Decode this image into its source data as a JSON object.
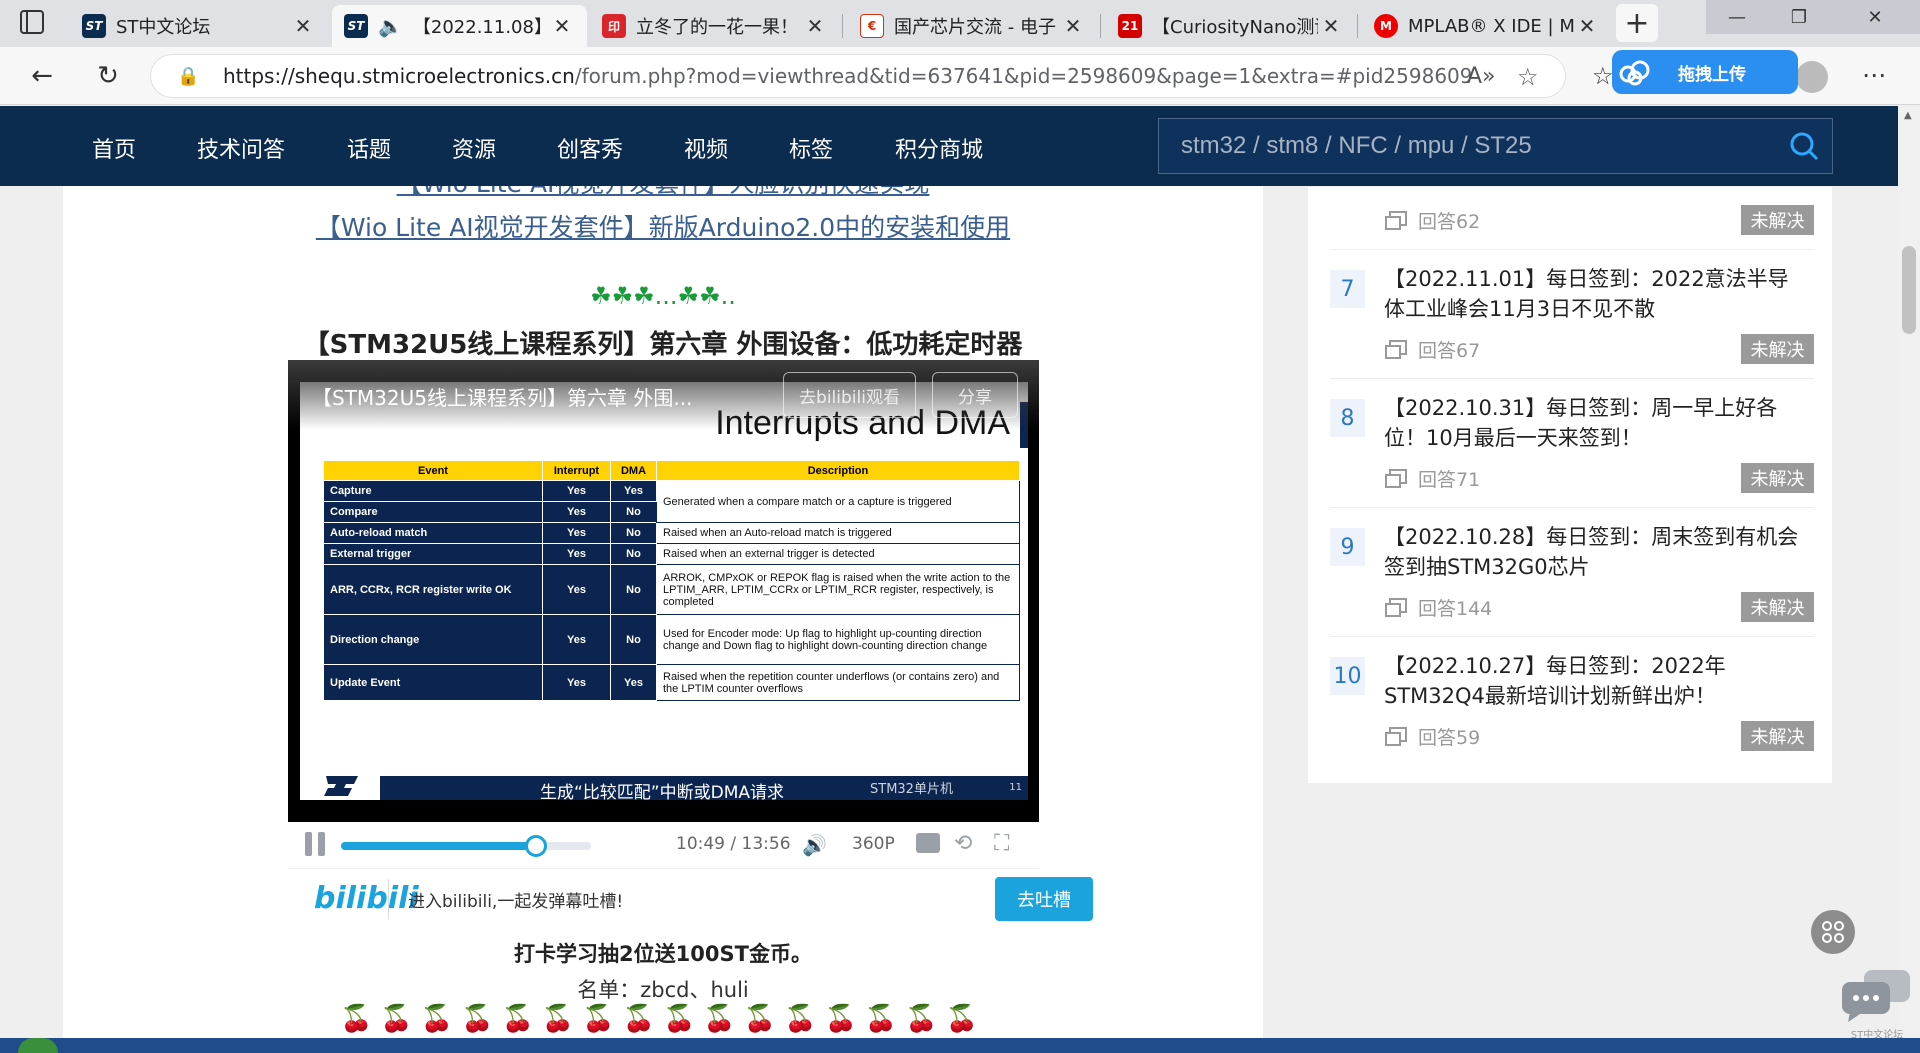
{
  "browser": {
    "tabs": [
      {
        "title": "ST中文论坛",
        "icon": "st-logo-icon"
      },
      {
        "title": "【2022.11.08】",
        "icon": "st-logo-icon"
      },
      {
        "title": "立冬了的一花一果！",
        "icon": "red-app-icon"
      },
      {
        "title": "国产芯片交流 - 电子",
        "icon": "eefocus-icon"
      },
      {
        "title": "【CuriosityNano测评",
        "icon": "21ic-icon"
      },
      {
        "title": "MPLAB® X IDE | Mi",
        "icon": "microchip-icon"
      }
    ],
    "url_host": "https://shequ.stmicroelectronics.cn",
    "url_path": "/forum.php?mod=viewthread&tid=637641&pid=2598609&page=1&extra=#pid2598609",
    "upload_label": "拖拽上传"
  },
  "site_nav": {
    "items": [
      "首页",
      "技术问答",
      "话题",
      "资源",
      "创客秀",
      "视频",
      "标签",
      "积分商城"
    ],
    "search_placeholder": "stm32 / stm8 / NFC / mpu / ST25"
  },
  "article": {
    "link_partial": "【Wio Lite AI视觉开发套件】人脸识别快速实现",
    "link_2": "【Wio Lite AI视觉开发套件】新版Arduino2.0中的安装和使用",
    "deco_clovers": "☘☘☘...☘☘..",
    "section_title": "【STM32U5线上课程系列】第六章 外围设备：低功耗定时器",
    "video": {
      "title": "【STM32U5线上课程系列】第六章 外围...",
      "open_bilibili": "去bilibili观看",
      "share": "分享",
      "slide_heading": "Interrupts and DMA",
      "table_headers": [
        "Event",
        "Interrupt",
        "DMA",
        "Description"
      ],
      "table_rows": [
        {
          "event": "Capture",
          "int": "Yes",
          "dma": "Yes",
          "desc": "Generated when a compare match or a capture is triggered"
        },
        {
          "event": "Compare",
          "int": "Yes",
          "dma": "No",
          "desc": ""
        },
        {
          "event": "Auto-reload match",
          "int": "Yes",
          "dma": "No",
          "desc": "Raised when an Auto-reload match is triggered"
        },
        {
          "event": "External trigger",
          "int": "Yes",
          "dma": "No",
          "desc": "Raised when an external trigger is detected"
        },
        {
          "event": "ARR, CCRx, RCR register write OK",
          "int": "Yes",
          "dma": "No",
          "desc": "ARROK, CMPxOK or REPOK flag is raised when the write action to the LPTIM_ARR, LPTIM_CCRx or LPTIM_RCR register, respectively, is completed"
        },
        {
          "event": "Direction change",
          "int": "Yes",
          "dma": "No",
          "desc": "Used for Encoder mode: Up flag to highlight up-counting direction change and Down flag to highlight down-counting direction change"
        },
        {
          "event": "Update Event",
          "int": "Yes",
          "dma": "Yes",
          "desc": "Raised when the repetition counter underflows (or contains zero) and the LPTIM counter overflows"
        }
      ],
      "slide_caption": "生成“比较匹配”中断或DMA请求",
      "slide_watermark": "STM32单片机",
      "slide_page": "11",
      "time_current": "10:49",
      "time_sep": "/",
      "time_total": "13:56",
      "progress": 0.78,
      "quality": "360P",
      "danmaku_hint": "进入bilibili,一起发弹幕吐槽!",
      "danmaku_button": "去吐槽",
      "bili_logo": "bilibili"
    },
    "reward_text": "打卡学习抽2位送100ST金币。",
    "winners": "名单：zbcd、huli",
    "cherries": "🍒🍒🍒🍒🍒🍒🍒🍒🍒🍒🍒🍒🍒🍒🍒🍒"
  },
  "sidebar": {
    "items": [
      {
        "rank": "",
        "title": "",
        "answers": "回答62",
        "status": "未解决"
      },
      {
        "rank": "7",
        "title": "【2022.11.01】每日签到：2022意法半导体工业峰会11月3日不见不散",
        "answers": "回答67",
        "status": "未解决"
      },
      {
        "rank": "8",
        "title": "【2022.10.31】每日签到：周一早上好各位！10月最后一天来签到！",
        "answers": "回答71",
        "status": "未解决"
      },
      {
        "rank": "9",
        "title": "【2022.10.28】每日签到：周末签到有机会签到抽STM32G0芯片",
        "answers": "回答144",
        "status": "未解决"
      },
      {
        "rank": "10",
        "title": "【2022.10.27】每日签到：2022年STM32Q4最新培训计划新鲜出炉！",
        "answers": "回答59",
        "status": "未解决"
      }
    ]
  },
  "floating": {
    "chat_label": "ST中文论坛"
  },
  "colors": {
    "nav_bg": "#0b2b4f",
    "accent": "#1aa3dc",
    "badge": "#9a9a9a"
  }
}
